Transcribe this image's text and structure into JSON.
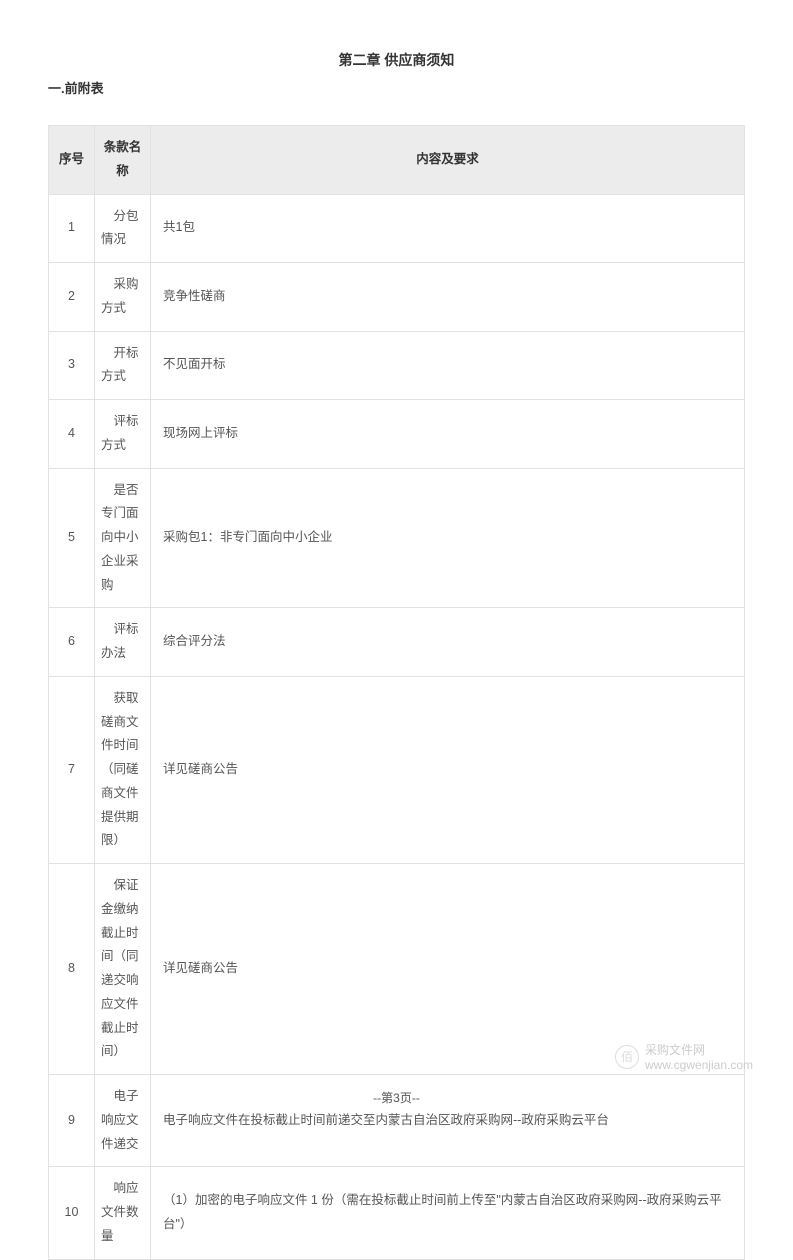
{
  "chapter_title": "第二章 供应商须知",
  "section_title": "一.前附表",
  "headers": {
    "num": "序号",
    "name": "条款名称",
    "content": "内容及要求"
  },
  "rows": [
    {
      "num": "1",
      "name": "分包情况",
      "content": "共1包"
    },
    {
      "num": "2",
      "name": "采购方式",
      "content": "竞争性磋商"
    },
    {
      "num": "3",
      "name": "开标方式",
      "content": "不见面开标"
    },
    {
      "num": "4",
      "name": "评标方式",
      "content": "现场网上评标"
    },
    {
      "num": "5",
      "name": "是否专门面向中小企业采购",
      "content": "采购包1：非专门面向中小企业"
    },
    {
      "num": "6",
      "name": "评标办法",
      "content": "综合评分法"
    },
    {
      "num": "7",
      "name": "获取磋商文件时间（同磋商文件提供期限）",
      "content": "详见磋商公告"
    },
    {
      "num": "8",
      "name": "保证金缴纳截止时间（同递交响应文件截止时间）",
      "content": "详见磋商公告"
    },
    {
      "num": "9",
      "name": "电子响应文件递交",
      "content": "电子响应文件在投标截止时间前递交至内蒙古自治区政府采购网--政府采购云平台"
    },
    {
      "num": "10",
      "name": "响应文件数量",
      "content": "（1）加密的电子响应文件 1 份（需在投标截止时间前上传至\"内蒙古自治区政府采购网--政府采购云平台\"）"
    }
  ],
  "watermark": {
    "icon_text": "佰",
    "text": "采购文件网",
    "url": "www.cgwenjian.com"
  },
  "page_footer": "--第3页--"
}
